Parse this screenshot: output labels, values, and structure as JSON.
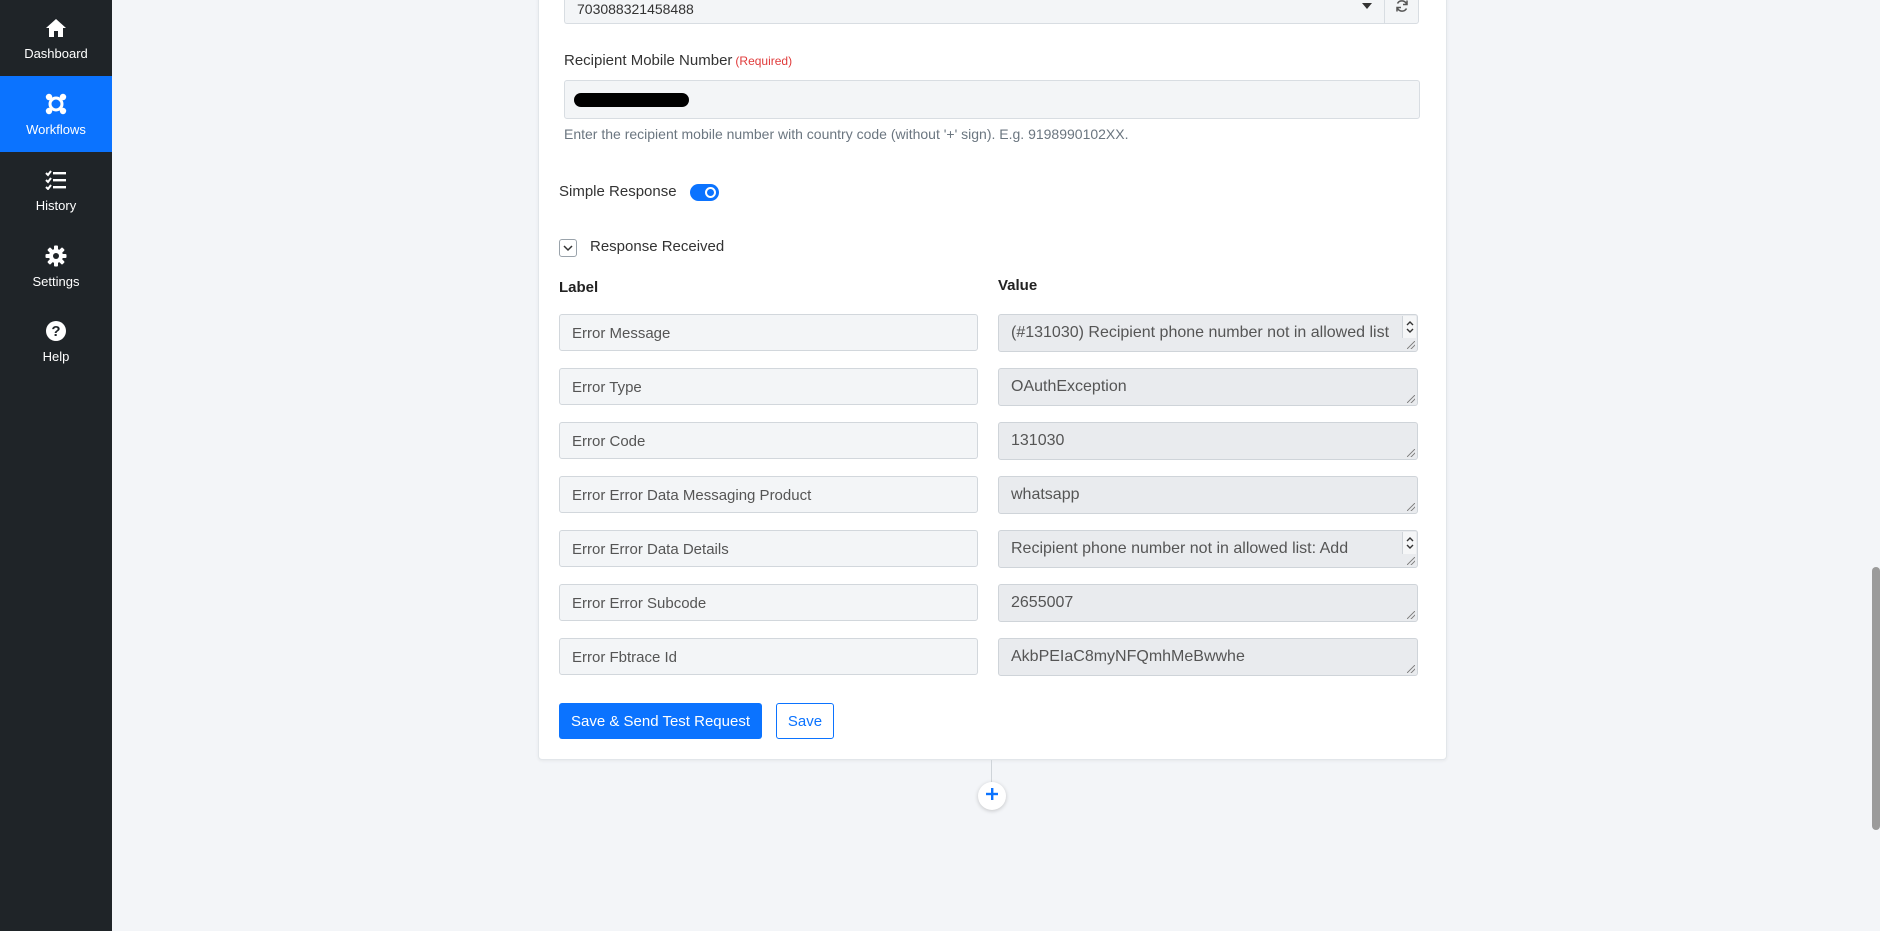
{
  "sidebar": {
    "items": [
      {
        "label": "Dashboard",
        "icon": "home-icon"
      },
      {
        "label": "Workflows",
        "icon": "workflow-icon",
        "active": true
      },
      {
        "label": "History",
        "icon": "list-check-icon"
      },
      {
        "label": "Settings",
        "icon": "gear-icon"
      },
      {
        "label": "Help",
        "icon": "help-circle-icon"
      }
    ]
  },
  "form": {
    "account_value": "703088321458488",
    "recipient_label": "Recipient Mobile Number",
    "required_tag": "(Required)",
    "recipient_help": "Enter the recipient mobile number with country code (without '+' sign). E.g. 9198990102XX.",
    "simple_response_label": "Simple Response",
    "simple_response_on": true,
    "response_received_label": "Response Received"
  },
  "response_table": {
    "label_header": "Label",
    "value_header": "Value",
    "rows": [
      {
        "label": "Error Message",
        "value": "(#131030) Recipient phone number not in allowed list"
      },
      {
        "label": "Error Type",
        "value": "OAuthException"
      },
      {
        "label": "Error Code",
        "value": "131030"
      },
      {
        "label": "Error Error Data Messaging Product",
        "value": "whatsapp"
      },
      {
        "label": "Error Error Data Details",
        "value": "Recipient phone number not in allowed list: Add"
      },
      {
        "label": "Error Error Subcode",
        "value": "2655007"
      },
      {
        "label": "Error Fbtrace Id",
        "value": "AkbPEIaC8myNFQmhMeBwwhe"
      }
    ]
  },
  "actions": {
    "save_send_label": "Save & Send Test Request",
    "save_label": "Save"
  },
  "colors": {
    "sidebar_bg": "#1f2428",
    "accent": "#0b73ff",
    "required": "#e03b3b"
  }
}
